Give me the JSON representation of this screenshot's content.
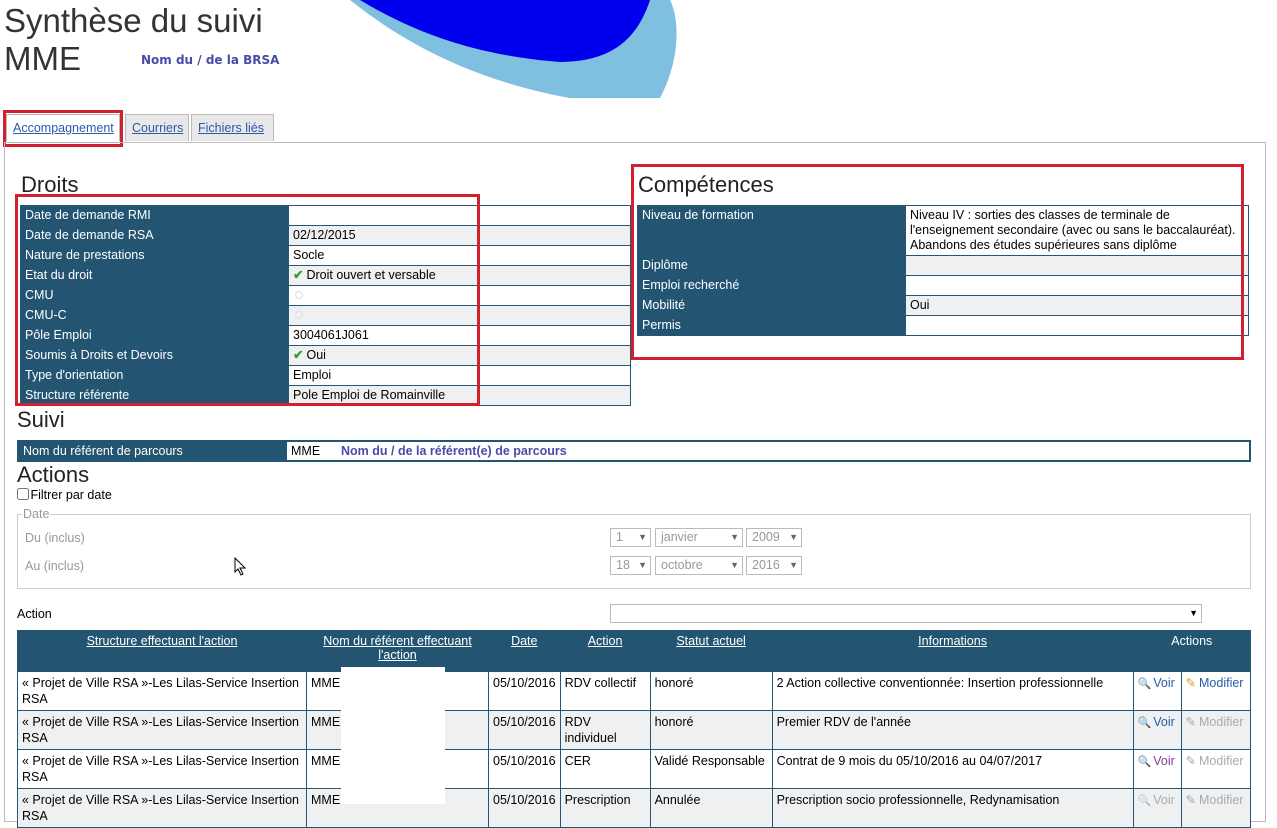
{
  "header": {
    "title_line1": "Synthèse du suivi",
    "title_line2": "MME",
    "brsa_name": "Nom du / de la BRSA"
  },
  "tabs": [
    {
      "label": "Accompagnement",
      "active": true
    },
    {
      "label": "Courriers",
      "active": false
    },
    {
      "label": "Fichiers liés",
      "active": false
    }
  ],
  "droits": {
    "title": "Droits",
    "rows": [
      {
        "label": "Date de demande RMI",
        "value": ""
      },
      {
        "label": "Date de demande RSA",
        "value": "02/12/2015"
      },
      {
        "label": "Nature de prestations",
        "value": "Socle"
      },
      {
        "label": "Etat du droit",
        "value": "Droit ouvert et versable",
        "icon": "check-icon"
      },
      {
        "label": "CMU",
        "value": ""
      },
      {
        "label": "CMU-C",
        "value": ""
      },
      {
        "label": "Pôle Emploi",
        "value": "3004061J061"
      },
      {
        "label": "Soumis à Droits et Devoirs",
        "value": "Oui",
        "icon": "check-icon"
      },
      {
        "label": "Type d'orientation",
        "value": "Emploi"
      },
      {
        "label": "Structure référente",
        "value": "Pole Emploi de Romainville"
      }
    ]
  },
  "competences": {
    "title": "Compétences",
    "rows": [
      {
        "label": "Niveau de formation",
        "value": "Niveau IV : sorties des classes de terminale de l'enseignement secondaire (avec ou sans le baccalauréat). Abandons des études supérieures sans diplôme"
      },
      {
        "label": "Diplôme",
        "value": ""
      },
      {
        "label": "Emploi recherché",
        "value": ""
      },
      {
        "label": "Mobilité",
        "value": "Oui"
      },
      {
        "label": "Permis",
        "value": ""
      }
    ]
  },
  "suivi": {
    "title": "Suivi",
    "referent_label": "Nom du référent de parcours",
    "referent_civilite": "MME",
    "referent_name": "Nom du / de la référent(e) de parcours"
  },
  "actions_section": {
    "title": "Actions",
    "filter_label": "Filtrer par date",
    "fieldset_legend": "Date",
    "du_label": "Du (inclus)",
    "au_label": "Au (inclus)",
    "du": {
      "day": "1",
      "month": "janvier",
      "year": "2009"
    },
    "au": {
      "day": "18",
      "month": "octobre",
      "year": "2016"
    },
    "action_label": "Action",
    "action_value": ""
  },
  "actions_table": {
    "headers": [
      "Structure effectuant l'action",
      "Nom du référent effectuant l'action",
      "Date",
      "Action",
      "Statut actuel",
      "Informations",
      "Actions"
    ],
    "rows": [
      {
        "structure": "« Projet de Ville RSA »-Les Lilas-Service Insertion RSA",
        "referent": "MME",
        "date": "05/10/2016",
        "action": "RDV collectif",
        "statut": "honoré",
        "info": "2 Action collective conventionnée: Insertion professionnelle",
        "voir": "Voir",
        "modifier": "Modifier"
      },
      {
        "structure": "« Projet de Ville RSA »-Les Lilas-Service Insertion RSA",
        "referent": "MME",
        "date": "05/10/2016",
        "action": "RDV individuel",
        "statut": "honoré",
        "info": "Premier RDV de l'année",
        "voir": "Voir",
        "modifier": "Modifier"
      },
      {
        "structure": "« Projet de Ville RSA »-Les Lilas-Service Insertion RSA",
        "referent": "MME",
        "date": "05/10/2016",
        "action": "CER",
        "statut": "Validé Responsable",
        "info": "Contrat de 9 mois du 05/10/2016 au 04/07/2017",
        "voir": "Voir",
        "modifier": "Modifier"
      },
      {
        "structure": "« Projet de Ville RSA »-Les Lilas-Service Insertion RSA",
        "referent": "MME",
        "date": "05/10/2016",
        "action": "Prescription",
        "statut": "Annulée",
        "info": "Prescription socio professionnelle, Redynamisation",
        "voir": "Voir",
        "modifier": "Modifier"
      }
    ]
  },
  "colors": {
    "header_blue": "#235572",
    "highlight_red": "#d22030",
    "link": "#2a5aa8",
    "logo_blue": "#0000ee",
    "logo_light": "#7fbfe0"
  }
}
